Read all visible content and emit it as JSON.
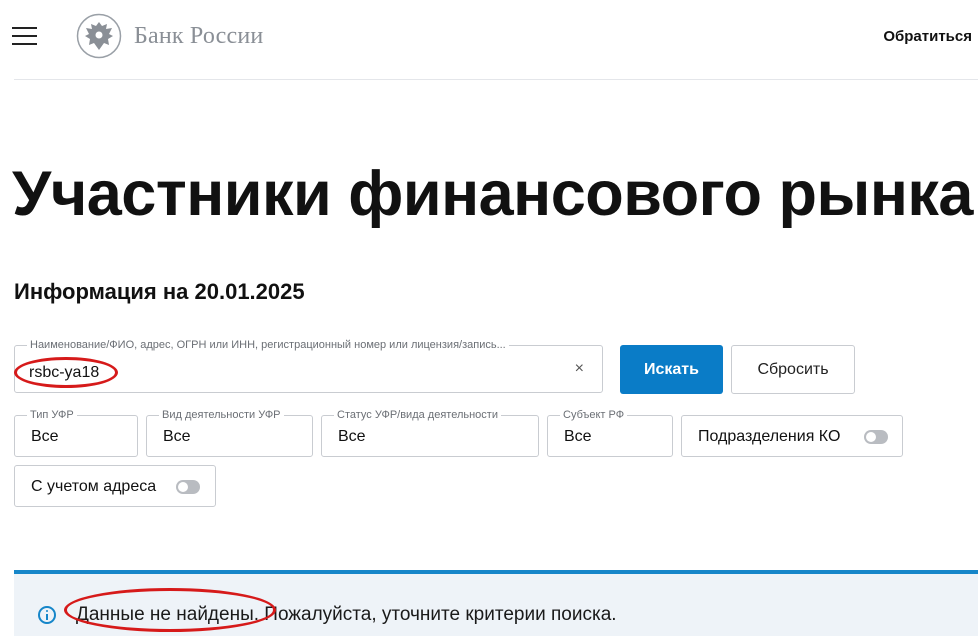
{
  "header": {
    "logo_text": "Банк России",
    "contact_label": "Обратиться"
  },
  "page": {
    "title": "Участники финансового рынка",
    "info_date": "Информация на 20.01.2025"
  },
  "search": {
    "label": "Наименование/ФИО, адрес, ОГРН или ИНН, регистрационный номер или лицензия/запись...",
    "value": "rsbc-ya18",
    "clear_symbol": "×",
    "search_button": "Искать",
    "reset_button": "Сбросить"
  },
  "filters": {
    "type": {
      "label": "Тип УФР",
      "value": "Все"
    },
    "activity": {
      "label": "Вид деятельности УФР",
      "value": "Все"
    },
    "status": {
      "label": "Статус УФР/вида деятельности",
      "value": "Все"
    },
    "region": {
      "label": "Субъект РФ",
      "value": "Все"
    },
    "branches_toggle": {
      "label": "Подразделения КО",
      "on": false
    },
    "address_toggle": {
      "label": "С учетом адреса",
      "on": false
    }
  },
  "alert": {
    "icon": "info-icon",
    "text": "Данные не найдены. Пожалуйста, уточните критерии поиска."
  },
  "colors": {
    "accent": "#0a7cc7",
    "alert_border": "#1686c9",
    "alert_bg": "#eef3f8",
    "annotation": "#d61a1a"
  }
}
